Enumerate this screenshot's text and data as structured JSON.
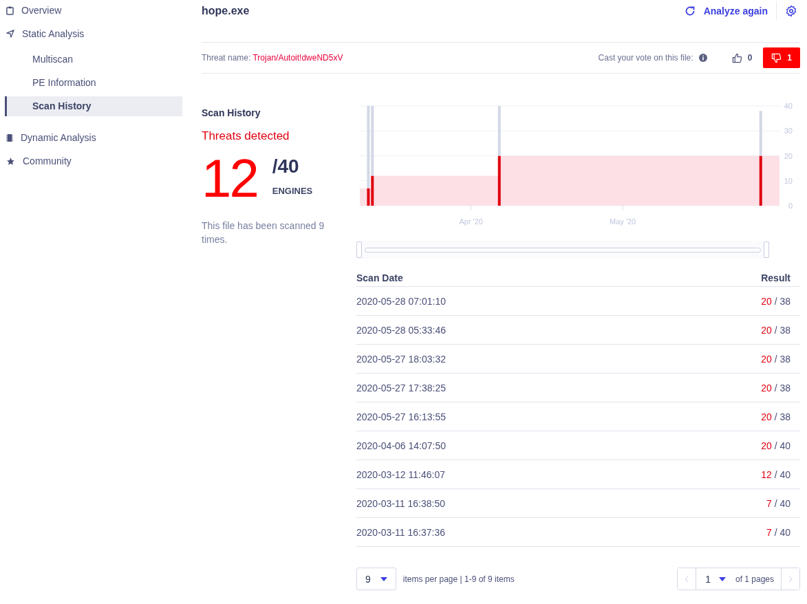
{
  "sidebar": {
    "items": [
      {
        "label": "Overview",
        "selected": false
      },
      {
        "label": "Static Analysis",
        "selected": false,
        "children": [
          {
            "label": "Multiscan",
            "selected": false
          },
          {
            "label": "PE Information",
            "selected": false
          },
          {
            "label": "Scan History",
            "selected": true
          }
        ]
      },
      {
        "label": "Dynamic Analysis",
        "selected": false
      },
      {
        "label": "Community",
        "selected": false
      }
    ]
  },
  "header": {
    "title": "hope.exe",
    "analyze_button": "Analyze again"
  },
  "threat": {
    "label": "Threat name:",
    "name": "Trojan/Autoit!dweND5xV",
    "vote_label": "Cast your vote on this file:",
    "votes": [
      {
        "kind": "up",
        "count": "0",
        "selected": false
      },
      {
        "kind": "down",
        "count": "1",
        "selected": true
      }
    ]
  },
  "summary": {
    "heading": "Scan History",
    "status": "Threats detected",
    "detected": "12",
    "total": "/40",
    "unit": "ENGINES",
    "note": "This file has been scanned 9 times."
  },
  "chart_data": {
    "type": "bar",
    "x": [
      "2020-03-11 16:38",
      "2020-03-12 11:46",
      "2020-04-06 14:07",
      "2020-05-28 07:01"
    ],
    "stacked": true,
    "grid": true,
    "series": [
      {
        "color": "#e00010",
        "values": [
          7,
          12,
          20,
          20
        ]
      },
      {
        "color": "#d3d8e6",
        "values": [
          33,
          28,
          20,
          18
        ]
      }
    ],
    "xlim": [
      "2020-03-10 00:00",
      "2020-06-01 00:00"
    ],
    "ylim": [
      0,
      40
    ],
    "yticks": [
      0,
      10,
      20,
      30,
      40
    ],
    "xticks": [
      {
        "value": "2020-04-01 00:00",
        "label": "Apr '20"
      },
      {
        "value": "2020-05-01 00:00",
        "label": "May '20"
      }
    ]
  },
  "range_selector": {
    "level": 1
  },
  "table": {
    "columns": [
      "Scan Date",
      "Result"
    ],
    "rows": [
      {
        "date": "2020-05-28 07:01:10",
        "detected": "20",
        "total": "/ 38"
      },
      {
        "date": "2020-05-28 05:33:46",
        "detected": "20",
        "total": "/ 38"
      },
      {
        "date": "2020-05-27 18:03:32",
        "detected": "20",
        "total": "/ 38"
      },
      {
        "date": "2020-05-27 17:38:25",
        "detected": "20",
        "total": "/ 38"
      },
      {
        "date": "2020-05-27 16:13:55",
        "detected": "20",
        "total": "/ 38"
      },
      {
        "date": "2020-04-06 14:07:50",
        "detected": "20",
        "total": "/ 40"
      },
      {
        "date": "2020-03-12 11:46:07",
        "detected": "12",
        "total": "/ 40"
      },
      {
        "date": "2020-03-11 16:38:50",
        "detected": "7",
        "total": "/ 40"
      },
      {
        "date": "2020-03-11 16:37:36",
        "detected": "7",
        "total": "/ 40"
      }
    ]
  },
  "pagination": {
    "page_size": "9",
    "per_page_label": "items per page | 1-9 of 9 items",
    "page": "1",
    "pages_label": "of 1 pages"
  }
}
